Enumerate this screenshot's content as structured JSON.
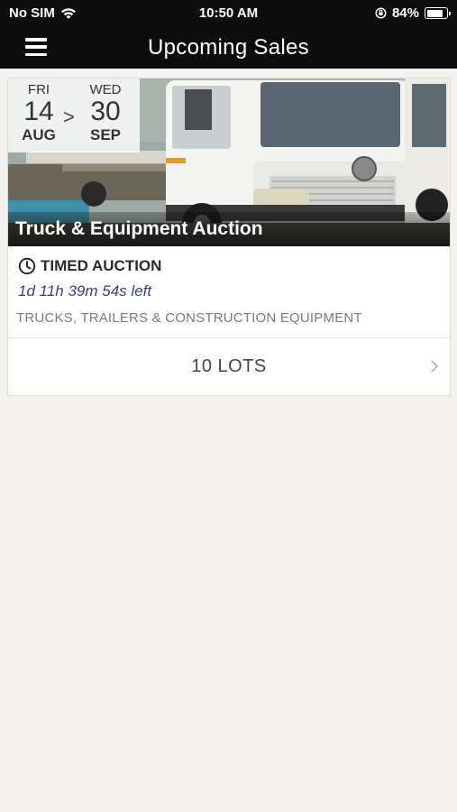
{
  "status_bar": {
    "carrier": "No SIM",
    "time": "10:50 AM",
    "battery": "84%",
    "battery_level": 0.84
  },
  "nav": {
    "title": "Upcoming Sales",
    "menu_icon": "hamburger-menu-icon"
  },
  "sale": {
    "start": {
      "day": "FRI",
      "date": "14",
      "month": "AUG"
    },
    "arrow": ">",
    "end": {
      "day": "WED",
      "date": "30",
      "month": "SEP"
    },
    "title": "Truck & Equipment Auction",
    "type_icon": "clock-icon",
    "type": "TIMED AUCTION",
    "countdown": "1d 11h 39m 54s left",
    "category": "TRUCKS, TRAILERS & CONSTRUCTION EQUIPMENT",
    "lots": "10 LOTS",
    "accent": "#3a3a8c"
  }
}
